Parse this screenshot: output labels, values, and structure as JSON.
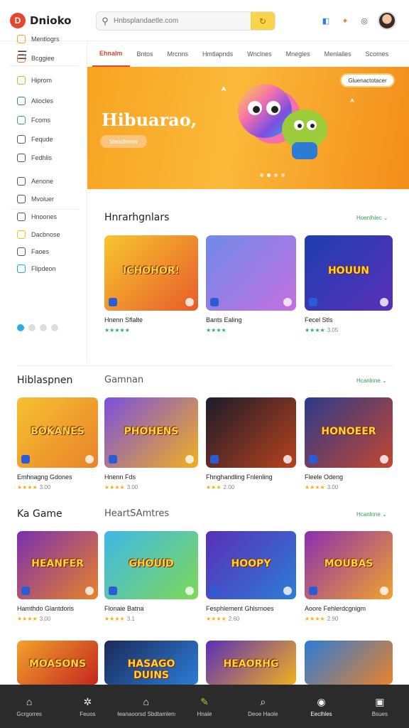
{
  "app": {
    "logo_text": "Dnioko",
    "logo_mark": "D"
  },
  "search": {
    "placeholder": "Hnbsplandaetle.com",
    "icon": "search-icon",
    "button_icon": "refresh-icon"
  },
  "header_icons": [
    {
      "name": "shop-icon",
      "glyph": "◧",
      "color": "#2c7cd6"
    },
    {
      "name": "gift-icon",
      "glyph": "✦",
      "color": "#e6782f"
    },
    {
      "name": "settings-icon",
      "glyph": "◎",
      "color": "#555555"
    }
  ],
  "sidebar": {
    "menu_icon": "☰",
    "items": [
      {
        "label": "Mentlogrs",
        "color": "#f2a22c"
      },
      {
        "label": "Bcggiee",
        "color": "#f26b3a"
      },
      {
        "label": "Hiprom",
        "color": "#f2a22c"
      },
      {
        "label": "Aliocles",
        "color": "#2c7cd6"
      },
      {
        "label": "Fcoms",
        "color": "#2eae6b"
      },
      {
        "label": "Fequde",
        "color": "#555555"
      },
      {
        "label": "Fedhlis",
        "color": "#555555"
      },
      {
        "label": "Aenone",
        "color": "#555555"
      },
      {
        "label": "Mvoluer",
        "color": "#555555"
      },
      {
        "label": "Hnoones",
        "color": "#555555"
      },
      {
        "label": "Dacbnose",
        "color": "#f2c01e"
      },
      {
        "label": "Faoes",
        "color": "#555555"
      },
      {
        "label": "Flipdeon",
        "color": "#1da1f2"
      }
    ]
  },
  "tabs": [
    "Ehnalm",
    "Bntos",
    "Mrcnns",
    "Hmtlapnds",
    "Wnclnes",
    "Mnegles",
    "Menlalles",
    "Scomes"
  ],
  "tabs_active_index": 0,
  "banner": {
    "title": "Hibuarao,",
    "cta": "Stendlemer",
    "pill": "Gluenactotacer",
    "dots": 4,
    "active_dot": 1
  },
  "sections": [
    {
      "title": "Hnrarhgnlars",
      "subtitle": "",
      "more": "Hoenlhlec ⌄",
      "cards": [
        {
          "title": "Hnenn Sflalte",
          "thumb_text": "ICHOHOR!",
          "stars": "★★★★★",
          "rating": "",
          "bg": "linear-gradient(135deg,#f7c62f,#e85b2a)"
        },
        {
          "title": "Bants Ealing",
          "thumb_text": "",
          "stars": "★★★★",
          "rating": "",
          "bg": "linear-gradient(135deg,#6f8be8,#c46fe0)"
        },
        {
          "title": "Fecel Stls",
          "thumb_text": "HOUUN",
          "stars": "★★★★",
          "rating": "3.05",
          "bg": "linear-gradient(135deg,#1d3fb0,#5a2fb8)"
        }
      ]
    },
    {
      "title": "Hiblaspnen",
      "subtitle": "Gamnan",
      "more": "Hcanlnne ⌄",
      "cards": [
        {
          "title": "Emhnagng Gdones",
          "thumb_text": "BOKANES",
          "stars": "★★★★",
          "rating": "3.00",
          "bg": "linear-gradient(135deg,#f5c130,#e9822a)"
        },
        {
          "title": "Hnenn Fds",
          "thumb_text": "PHOHENS",
          "stars": "★★★★",
          "rating": "3.00",
          "bg": "linear-gradient(135deg,#7a4fe0,#f2b01e)"
        },
        {
          "title": "Fhnghandling Fnlenling",
          "thumb_text": "",
          "stars": "★★★",
          "rating": "2.00",
          "bg": "linear-gradient(135deg,#1b1b2b,#b8421c)"
        },
        {
          "title": "Fleele Odeng",
          "thumb_text": "HONOEER",
          "stars": "★★★★",
          "rating": "3.00",
          "bg": "linear-gradient(135deg,#2b3a8c,#c4462f)"
        }
      ]
    },
    {
      "title": "Ka Game",
      "subtitle": "HeartSAmtres",
      "more": "Hcanlnne ⌄",
      "cards": [
        {
          "title": "Hamthdo Glantdoris",
          "thumb_text": "HEANFER",
          "stars": "★★★★",
          "rating": "3.00",
          "bg": "linear-gradient(135deg,#7a2fb0,#e9822a)"
        },
        {
          "title": "Flonaie Batna",
          "thumb_text": "GHOUID",
          "stars": "★★★★",
          "rating": "3.1",
          "bg": "linear-gradient(135deg,#3fb7e8,#7ed957)"
        },
        {
          "title": "Fesphlement Ghlsrnoes",
          "thumb_text": "HOOPY",
          "stars": "★★★★",
          "rating": "2.60",
          "bg": "linear-gradient(135deg,#5a2fb8,#2c7cd6)"
        },
        {
          "title": "Aoore Fehlerdcgnigm",
          "thumb_text": "MOUBAS",
          "stars": "★★★★",
          "rating": "2.90",
          "bg": "linear-gradient(135deg,#8a2fb0,#f2a22c)"
        }
      ]
    },
    {
      "title": "",
      "subtitle": "",
      "more": "",
      "cards": [
        {
          "title": "",
          "thumb_text": "MOASONS",
          "stars": "",
          "rating": "",
          "bg": "linear-gradient(135deg,#f2a22c,#c4261f)"
        },
        {
          "title": "",
          "thumb_text": "HASAGO DUINS",
          "stars": "",
          "rating": "",
          "bg": "linear-gradient(135deg,#1b2a5a,#2c7cd6)"
        },
        {
          "title": "",
          "thumb_text": "HEAORHG",
          "stars": "",
          "rating": "",
          "bg": "linear-gradient(135deg,#5a2fb8,#f2b01e)"
        },
        {
          "title": "",
          "thumb_text": "",
          "stars": "",
          "rating": "",
          "bg": "linear-gradient(135deg,#2c7cd6,#e9822a)"
        }
      ]
    }
  ],
  "bottom_nav": [
    {
      "label": "Gcrgorres",
      "icon": "home-icon",
      "glyph": "⌂",
      "color": "#eeeeee"
    },
    {
      "label": "Feuos",
      "icon": "star-icon",
      "glyph": "✲",
      "color": "#eeeeee"
    },
    {
      "label": "Heanaoorsd Sbdtamlens",
      "icon": "house-icon",
      "glyph": "⌂",
      "color": "#eeeeee"
    },
    {
      "label": "Hnale",
      "icon": "pen-icon",
      "glyph": "✎",
      "color": "#9ccc3a"
    },
    {
      "label": "Deoe Haole",
      "icon": "magnifier-icon",
      "glyph": "⌕",
      "color": "#eeeeee"
    },
    {
      "label": "Eeclhles",
      "icon": "disc-icon",
      "glyph": "◉",
      "color": "#ffffff"
    },
    {
      "label": "Bsues",
      "icon": "bag-icon",
      "glyph": "▣",
      "color": "#eeeeee"
    }
  ],
  "bottom_nav_active_index": 5
}
